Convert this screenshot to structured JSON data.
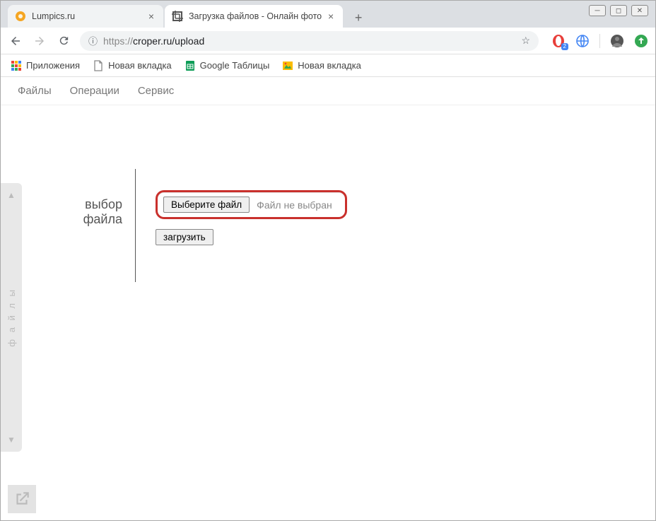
{
  "window": {
    "tabs": [
      {
        "title": "Lumpics.ru",
        "active": false
      },
      {
        "title": "Загрузка файлов - Онлайн фото",
        "active": true
      }
    ],
    "url_protocol": "https://",
    "url_rest": "croper.ru/upload"
  },
  "bookmarks": [
    {
      "label": "Приложения"
    },
    {
      "label": "Новая вкладка"
    },
    {
      "label": "Google Таблицы"
    },
    {
      "label": "Новая вкладка"
    }
  ],
  "app": {
    "menubar": [
      "Файлы",
      "Операции",
      "Сервис"
    ],
    "sidebar_label": "ф а й л ы",
    "section_title_line1": "выбор",
    "section_title_line2": "файла",
    "file_button": "Выберите файл",
    "file_status": "Файл не выбран",
    "upload_button": "загрузить"
  },
  "ext_badge": "2"
}
